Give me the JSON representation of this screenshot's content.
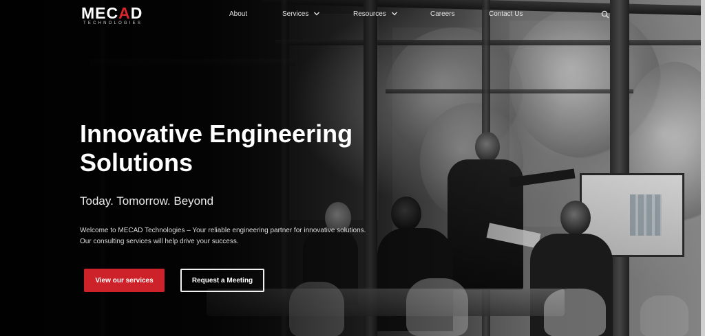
{
  "brand": {
    "logo_main_left": "MEC",
    "logo_main_mark": "A",
    "logo_main_right": "D",
    "logo_sub": "TECHNOLOGIES",
    "accent_color": "#d8262a"
  },
  "nav": {
    "items": [
      {
        "label": "About",
        "has_dropdown": false
      },
      {
        "label": "Services",
        "has_dropdown": true
      },
      {
        "label": "Resources",
        "has_dropdown": true
      },
      {
        "label": "Careers",
        "has_dropdown": false
      },
      {
        "label": "Contact Us",
        "has_dropdown": false
      }
    ],
    "search_icon": "search-icon"
  },
  "hero": {
    "title": "Innovative Engineering Solutions",
    "tagline": "Today. Tomorrow. Beyond",
    "intro": "Welcome to MECAD Technologies – Your reliable engineering partner for innovative solutions. Our consulting services will help drive your success.",
    "primary_button": "View our services",
    "secondary_button": "Request a Meeting",
    "primary_color": "#cd2229"
  }
}
